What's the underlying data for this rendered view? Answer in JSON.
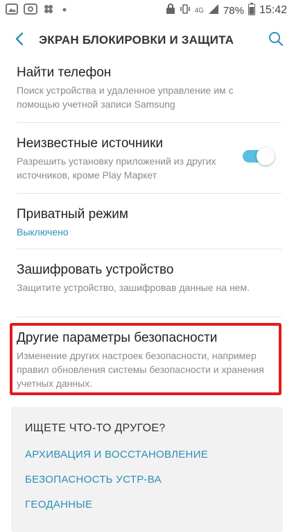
{
  "status_bar": {
    "battery_percent": "78%",
    "time": "15:42",
    "network": "4G"
  },
  "app_bar": {
    "title": "ЭКРАН БЛОКИРОВКИ И ЗАЩИТА"
  },
  "settings": [
    {
      "title": "Найти телефон",
      "subtitle": "Поиск устройства и удаленное управление им с помощью учетной записи Samsung"
    },
    {
      "title": "Неизвестные источники",
      "subtitle": "Разрешить установку приложений из других источников, кроме Play Маркет",
      "toggle_on": true
    },
    {
      "title": "Приватный режим",
      "subtitle": "Выключено"
    },
    {
      "title": "Зашифровать устройство",
      "subtitle": "Защитите устройство, зашифровав данные на нем."
    },
    {
      "title": "Другие параметры безопасности",
      "subtitle": "Изменение других настроек безопасности, например правил обновления системы безопасности и хранения учетных данных."
    }
  ],
  "suggestions": {
    "title": "ИЩЕТЕ ЧТО-ТО ДРУГОЕ?",
    "links": [
      "АРХИВАЦИЯ И ВОССТАНОВЛЕНИЕ",
      "БЕЗОПАСНОСТЬ УСТР-ВА",
      "ГЕОДАННЫЕ"
    ]
  },
  "colors": {
    "accent": "#2a8fb8",
    "toggle": "#5bbfe0",
    "highlight": "#e21a1a"
  }
}
